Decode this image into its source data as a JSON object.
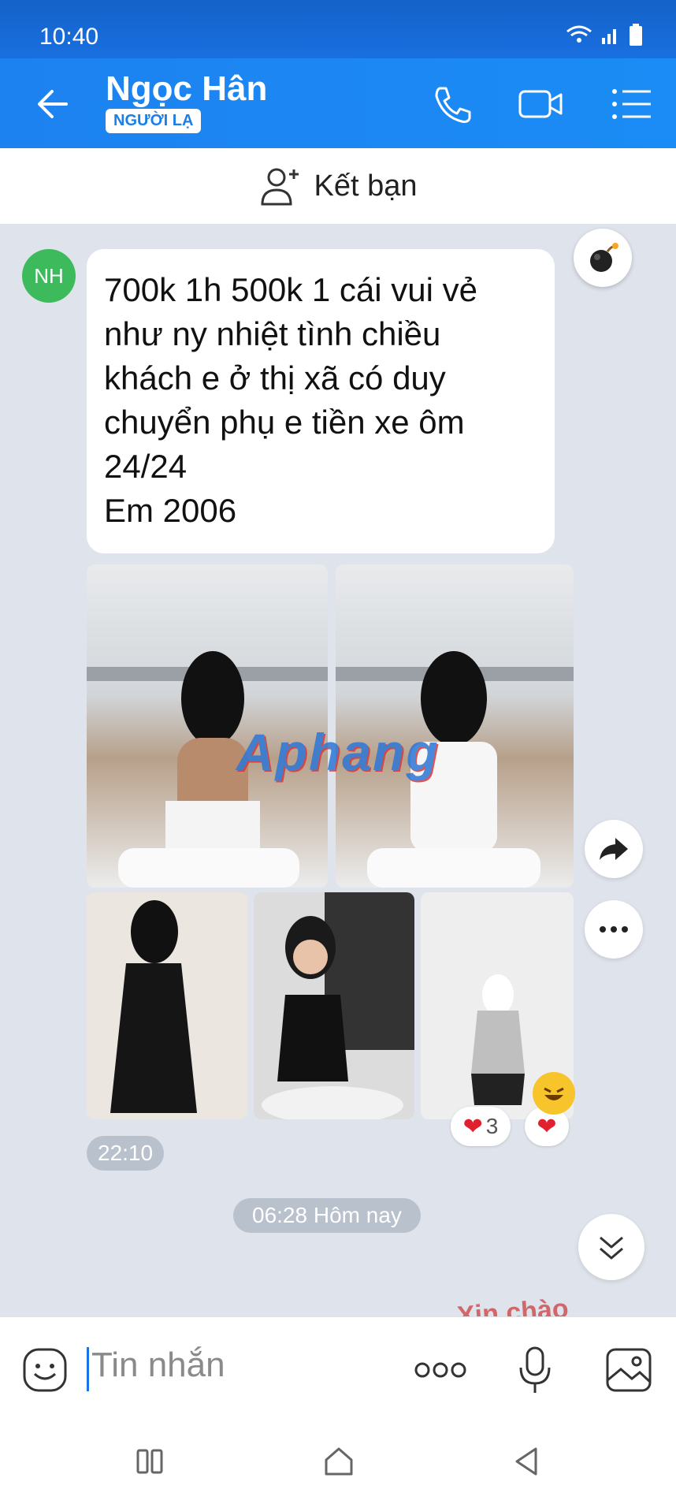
{
  "status": {
    "time": "10:40"
  },
  "header": {
    "title": "Ngọc Hân",
    "badge": "NGƯỜI LẠ"
  },
  "friend_bar": {
    "label": "Kết bạn"
  },
  "chat": {
    "avatar_initials": "NH",
    "message_text": "700k 1h 500k 1 cái vui vẻ\nnhư ny nhiệt tình chiều\nkhách e ở thị xã có duy\nchuyển phụ e tiền xe ôm\n24/24\nEm 2006",
    "watermark": "Aphang",
    "reactions": {
      "heart_count": "3"
    },
    "sent_time": "22:10",
    "date_divider": "06:28 Hôm nay",
    "next_message_snippet": "Xin chào"
  },
  "composer": {
    "placeholder": "Tin nhắn"
  },
  "colors": {
    "header": "#1b86f2",
    "avatar": "#3dbb5c",
    "accent": "#1a73e8"
  }
}
